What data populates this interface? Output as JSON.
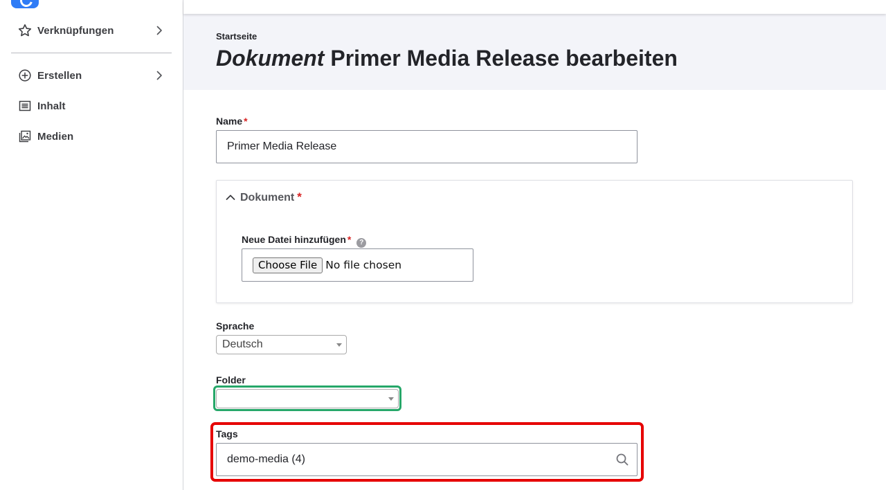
{
  "sidebar": {
    "items": [
      {
        "label": "Verknüpfungen",
        "icon": "star-icon",
        "has_submenu": true
      },
      {
        "label": "Erstellen",
        "icon": "plus-circle-icon",
        "has_submenu": true
      },
      {
        "label": "Inhalt",
        "icon": "content-list-icon",
        "has_submenu": false
      },
      {
        "label": "Medien",
        "icon": "media-image-icon",
        "has_submenu": false
      }
    ]
  },
  "header": {
    "breadcrumb": "Startseite",
    "title_type": "Dokument",
    "title_rest": "Primer Media Release bearbeiten"
  },
  "form": {
    "name": {
      "label": "Name",
      "required_mark": "*",
      "value": "Primer Media Release"
    },
    "document": {
      "summary": "Dokument",
      "required_mark": "*",
      "file_label": "Neue Datei hinzufügen",
      "file_required_mark": "*",
      "help_icon_glyph": "?",
      "choose_button": "Choose File",
      "file_status": "No file chosen"
    },
    "language": {
      "label": "Sprache",
      "selected": "Deutsch"
    },
    "folder": {
      "label": "Folder",
      "selected": ""
    },
    "tags": {
      "label": "Tags",
      "value": "demo-media (4)"
    }
  },
  "colors": {
    "accent_blue": "#2f7cf6",
    "required_red": "#d72222",
    "focus_green": "#26a769",
    "highlight_red": "#e60000",
    "header_bg": "#f3f4f9"
  }
}
